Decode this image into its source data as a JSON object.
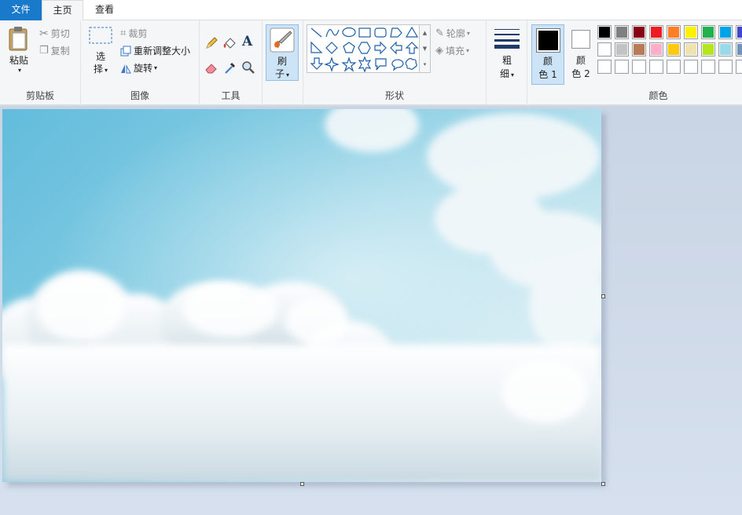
{
  "tabs": {
    "file": "文件",
    "home": "主页",
    "view": "查看"
  },
  "clipboard": {
    "paste": "粘贴",
    "cut": "剪切",
    "copy": "复制",
    "group": "剪贴板"
  },
  "image_group": {
    "select_1": "选",
    "select_2": "择",
    "crop": "裁剪",
    "resize": "重新调整大小",
    "rotate": "旋转",
    "group": "图像"
  },
  "tools": {
    "group": "工具",
    "text_glyph": "A"
  },
  "brushes": {
    "label_1": "刷",
    "label_2": "子"
  },
  "shapes": {
    "outline": "轮廓",
    "fill": "填充",
    "group": "形状"
  },
  "size": {
    "label_1": "粗",
    "label_2": "细"
  },
  "color1": {
    "label_1": "颜",
    "label_2": "色 1",
    "value": "#000000"
  },
  "color2": {
    "label_1": "颜",
    "label_2": "色 2",
    "value": "#ffffff"
  },
  "colors_group": "颜色",
  "palette": {
    "row1": [
      "#000000",
      "#7f7f7f",
      "#880015",
      "#ed1c24",
      "#ff7f27",
      "#fff200",
      "#22b14c",
      "#00a2e8",
      "#3f48cc"
    ],
    "row2": [
      "#ffffff",
      "#c3c3c3",
      "#b97a57",
      "#ffaec9",
      "#ffc90e",
      "#efe4b0",
      "#b5e61d",
      "#99d9ea",
      "#7092be"
    ],
    "row3": [
      "#ffffff",
      "#ffffff",
      "#ffffff",
      "#ffffff",
      "#ffffff",
      "#ffffff",
      "#ffffff",
      "#ffffff",
      "#ffffff"
    ]
  },
  "accent": "#1979ca"
}
